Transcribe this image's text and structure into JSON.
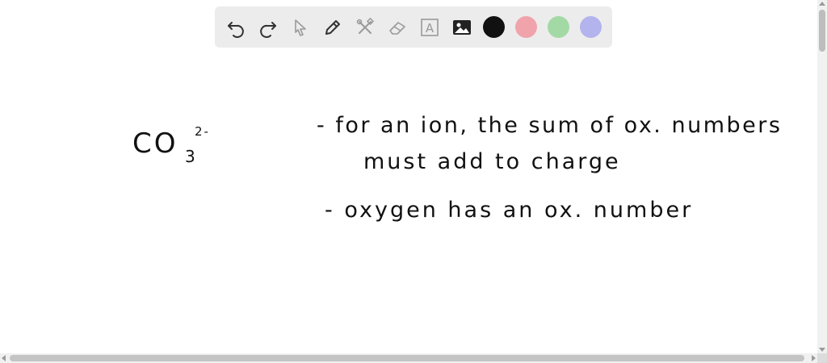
{
  "toolbar": {
    "tools": [
      {
        "name": "undo-icon"
      },
      {
        "name": "redo-icon"
      },
      {
        "name": "select-pointer-icon"
      },
      {
        "name": "pen-icon"
      },
      {
        "name": "tools-cross-icon"
      },
      {
        "name": "eraser-icon"
      },
      {
        "name": "text-tool-icon",
        "glyph": "A"
      },
      {
        "name": "image-icon"
      }
    ],
    "colors": [
      "#111111",
      "#f0a3ab",
      "#a3d9a5",
      "#b3b3ee"
    ]
  },
  "canvas": {
    "formula": {
      "base": "CO",
      "subscript": "3",
      "superscript": "2-"
    },
    "notes": {
      "line1": "- for an ion, the sum of ox. numbers",
      "line2": "must add to charge",
      "line3": "- oxygen has an ox. number"
    }
  }
}
